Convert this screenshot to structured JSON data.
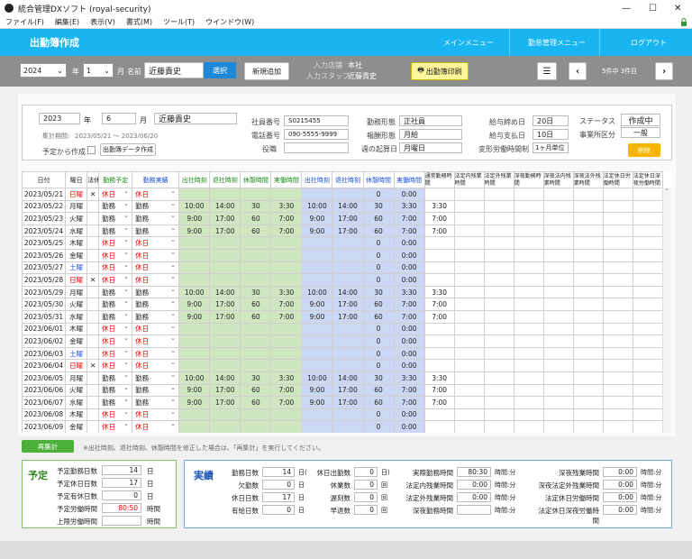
{
  "window": {
    "title": "統合管理DXソフト (royal-security)",
    "min": "—",
    "max": "☐",
    "close": "✕"
  },
  "menu": [
    "ファイル(F)",
    "編集(E)",
    "表示(V)",
    "書式(M)",
    "ツール(T)",
    "ウインドウ(W)"
  ],
  "header": {
    "title": "出勤簿作成",
    "nav": [
      "メインメニュー",
      "勤怠管理メニュー",
      "ログアウト"
    ]
  },
  "toolbar": {
    "year": "2024",
    "year_unit": "年",
    "month": "1",
    "month_unit": "月",
    "name_label": "名前",
    "name_value": "近藤貴史",
    "select_btn": "選択",
    "new_btn": "新規追加",
    "store_label": "入力店舗",
    "store_value": "本社",
    "staff_label": "入力スタッフ",
    "staff_value": "近藤貴史",
    "print_btn": "出勤簿印刷",
    "page_info": "5件中 3件目"
  },
  "info": {
    "year": "2023",
    "year_unit": "年",
    "month": "6",
    "month_unit": "月",
    "name": "近藤貴史",
    "period_label": "集計期間:",
    "period": "2023/05/21 〜 2023/06/20",
    "plan_label": "予定から作成",
    "data_btn": "出勤簿データ作成",
    "emp_no_label": "社員番号",
    "emp_no": "S0215455",
    "phone_label": "電話番号",
    "phone": "090-5555-9999",
    "role_label": "役職",
    "role": "",
    "work_type_label": "勤務形態",
    "work_type": "正社員",
    "pay_type_label": "報酬形態",
    "pay_type": "月給",
    "week_start_label": "週の起算日",
    "week_start": "月曜日",
    "close_label": "給与締め日",
    "close": "20日",
    "payday_label": "給与支払日",
    "payday": "10日",
    "flex_label": "変形労働時間制",
    "flex": "1ヶ月単位",
    "status_label": "ステータス",
    "status": "作成中",
    "div_label": "事業所区分",
    "div": "一般",
    "delete_btn": "削除"
  },
  "columns": [
    "日付",
    "曜日",
    "法休",
    "勤務予定",
    "勤務実績",
    "出社時刻",
    "退社時刻",
    "休憩時間",
    "実働時間",
    "出社時刻",
    "退社時刻",
    "休憩時間",
    "実働時間",
    "通常勤務時間",
    "法定内残業時間",
    "法定外残業時間",
    "深夜勤務時間",
    "深夜法内残業時間",
    "深夜法外残業時間",
    "法定休日労働時間",
    "法定休日深夜労働時間"
  ],
  "rows": [
    [
      "2023/05/21",
      "日曜",
      "✕",
      "休日",
      "休日",
      "",
      "",
      "",
      "",
      "",
      "",
      "0",
      "0:00",
      "",
      "",
      "",
      "",
      "",
      "",
      "",
      ""
    ],
    [
      "2023/05/22",
      "月曜",
      "",
      "勤務",
      "勤務",
      "10:00",
      "14:00",
      "30",
      "3:30",
      "10:00",
      "14:00",
      "30",
      "3:30",
      "3:30",
      "",
      "",
      "",
      "",
      "",
      "",
      ""
    ],
    [
      "2023/05/23",
      "火曜",
      "",
      "勤務",
      "勤務",
      "9:00",
      "17:00",
      "60",
      "7:00",
      "9:00",
      "17:00",
      "60",
      "7:00",
      "7:00",
      "",
      "",
      "",
      "",
      "",
      "",
      ""
    ],
    [
      "2023/05/24",
      "水曜",
      "",
      "勤務",
      "勤務",
      "9:00",
      "17:00",
      "60",
      "7:00",
      "9:00",
      "17:00",
      "60",
      "7:00",
      "7:00",
      "",
      "",
      "",
      "",
      "",
      "",
      ""
    ],
    [
      "2023/05/25",
      "木曜",
      "",
      "休日",
      "休日",
      "",
      "",
      "",
      "",
      "",
      "",
      "0",
      "0:00",
      "",
      "",
      "",
      "",
      "",
      "",
      "",
      ""
    ],
    [
      "2023/05/26",
      "金曜",
      "",
      "休日",
      "休日",
      "",
      "",
      "",
      "",
      "",
      "",
      "0",
      "0:00",
      "",
      "",
      "",
      "",
      "",
      "",
      "",
      ""
    ],
    [
      "2023/05/27",
      "土曜",
      "",
      "休日",
      "休日",
      "",
      "",
      "",
      "",
      "",
      "",
      "0",
      "0:00",
      "",
      "",
      "",
      "",
      "",
      "",
      "",
      ""
    ],
    [
      "2023/05/28",
      "日曜",
      "✕",
      "休日",
      "休日",
      "",
      "",
      "",
      "",
      "",
      "",
      "0",
      "0:00",
      "",
      "",
      "",
      "",
      "",
      "",
      "",
      ""
    ],
    [
      "2023/05/29",
      "月曜",
      "",
      "勤務",
      "勤務",
      "10:00",
      "14:00",
      "30",
      "3:30",
      "10:00",
      "14:00",
      "30",
      "3:30",
      "3:30",
      "",
      "",
      "",
      "",
      "",
      "",
      ""
    ],
    [
      "2023/05/30",
      "火曜",
      "",
      "勤務",
      "勤務",
      "9:00",
      "17:00",
      "60",
      "7:00",
      "9:00",
      "17:00",
      "60",
      "7:00",
      "7:00",
      "",
      "",
      "",
      "",
      "",
      "",
      ""
    ],
    [
      "2023/05/31",
      "水曜",
      "",
      "勤務",
      "勤務",
      "9:00",
      "17:00",
      "60",
      "7:00",
      "9:00",
      "17:00",
      "60",
      "7:00",
      "7:00",
      "",
      "",
      "",
      "",
      "",
      "",
      ""
    ],
    [
      "2023/06/01",
      "木曜",
      "",
      "休日",
      "休日",
      "",
      "",
      "",
      "",
      "",
      "",
      "0",
      "0:00",
      "",
      "",
      "",
      "",
      "",
      "",
      "",
      ""
    ],
    [
      "2023/06/02",
      "金曜",
      "",
      "休日",
      "休日",
      "",
      "",
      "",
      "",
      "",
      "",
      "0",
      "0:00",
      "",
      "",
      "",
      "",
      "",
      "",
      "",
      ""
    ],
    [
      "2023/06/03",
      "土曜",
      "",
      "休日",
      "休日",
      "",
      "",
      "",
      "",
      "",
      "",
      "0",
      "0:00",
      "",
      "",
      "",
      "",
      "",
      "",
      "",
      ""
    ],
    [
      "2023/06/04",
      "日曜",
      "✕",
      "休日",
      "休日",
      "",
      "",
      "",
      "",
      "",
      "",
      "0",
      "0:00",
      "",
      "",
      "",
      "",
      "",
      "",
      "",
      ""
    ],
    [
      "2023/06/05",
      "月曜",
      "",
      "勤務",
      "勤務",
      "10:00",
      "14:00",
      "30",
      "3:30",
      "10:00",
      "14:00",
      "30",
      "3:30",
      "3:30",
      "",
      "",
      "",
      "",
      "",
      "",
      ""
    ],
    [
      "2023/06/06",
      "火曜",
      "",
      "勤務",
      "勤務",
      "9:00",
      "17:00",
      "60",
      "7:00",
      "9:00",
      "17:00",
      "60",
      "7:00",
      "7:00",
      "",
      "",
      "",
      "",
      "",
      "",
      ""
    ],
    [
      "2023/06/07",
      "水曜",
      "",
      "勤務",
      "勤務",
      "9:00",
      "17:00",
      "60",
      "7:00",
      "9:00",
      "17:00",
      "60",
      "7:00",
      "7:00",
      "",
      "",
      "",
      "",
      "",
      "",
      ""
    ],
    [
      "2023/06/08",
      "木曜",
      "",
      "休日",
      "休日",
      "",
      "",
      "",
      "",
      "",
      "",
      "0",
      "0:00",
      "",
      "",
      "",
      "",
      "",
      "",
      "",
      ""
    ],
    [
      "2023/06/09",
      "金曜",
      "",
      "休日",
      "休日",
      "",
      "",
      "",
      "",
      "",
      "",
      "0",
      "0:00",
      "",
      "",
      "",
      "",
      "",
      "",
      "",
      ""
    ]
  ],
  "recalc": {
    "btn": "再集計",
    "note": "※出社時刻、退社時刻、休憩時間を修正した場合は、「再集計」を実行してください。"
  },
  "plan": {
    "title": "予定",
    "items": [
      {
        "label": "予定勤務日数",
        "value": "14",
        "unit": "日"
      },
      {
        "label": "予定休日日数",
        "value": "17",
        "unit": "日"
      },
      {
        "label": "予定有休日数",
        "value": "0",
        "unit": "日"
      },
      {
        "label": "予定労働時間",
        "value": "80:50",
        "unit": "時間"
      },
      {
        "label": "上限労働時間",
        "value": "",
        "unit": "時間"
      }
    ]
  },
  "actual": {
    "title": "実績",
    "c1": [
      {
        "label": "勤務日数",
        "value": "14",
        "unit": "日("
      },
      {
        "label": "欠勤数",
        "value": "0",
        "unit": "日"
      },
      {
        "label": "休日日数",
        "value": "17",
        "unit": "日"
      },
      {
        "label": "有給日数",
        "value": "0",
        "unit": "日"
      }
    ],
    "c2": [
      {
        "label": "休日出勤数",
        "value": "0",
        "unit": "日)"
      },
      {
        "label": "休業数",
        "value": "0",
        "unit": "回"
      },
      {
        "label": "遅刻数",
        "value": "0",
        "unit": "回"
      },
      {
        "label": "早退数",
        "value": "0",
        "unit": "回"
      }
    ],
    "c3": [
      {
        "label": "実際勤務時間",
        "value": "80:30",
        "unit": "時間:分"
      },
      {
        "label": "法定内残業時間",
        "value": "0:00",
        "unit": "時間:分"
      },
      {
        "label": "法定外残業時間",
        "value": "0:00",
        "unit": "時間:分"
      },
      {
        "label": "深夜勤務時間",
        "value": "",
        "unit": "時間:分"
      }
    ],
    "c4": [
      {
        "label": "深夜残業時間",
        "value": "0:00",
        "unit": "時間:分"
      },
      {
        "label": "深夜法定外残業時間",
        "value": "0:00",
        "unit": "時間:分"
      },
      {
        "label": "法定休日労働時間",
        "value": "0:00",
        "unit": "時間:分"
      },
      {
        "label": "法定休日深夜労働時間",
        "value": "0:00",
        "unit": "時間:分"
      }
    ]
  }
}
